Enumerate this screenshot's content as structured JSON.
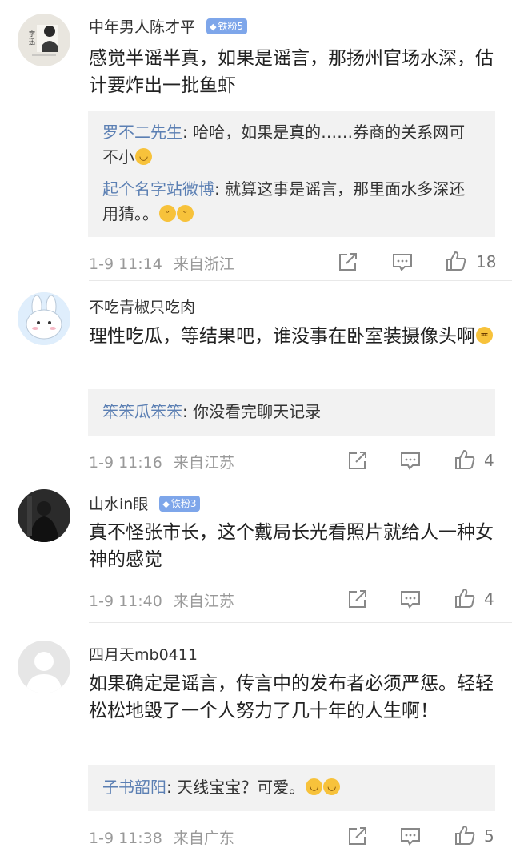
{
  "comments": [
    {
      "user": "中年男人陈才平",
      "badge": "铁粉5",
      "text": "感觉半谣半真，如果是谣言，那扬州官场水深，估计要炸出一批鱼虾",
      "replies": [
        {
          "name": "罗不二先生",
          "text": "哈哈，如果是真的……券商的关系网可不小"
        },
        {
          "name": "起个名字站微博",
          "text": "就算这事是谣言，那里面水多深还用猜。。"
        }
      ],
      "date": "1-9 11:14",
      "location": "来自浙江",
      "likes": "18"
    },
    {
      "user": "不吃青椒只吃肉",
      "badge": "",
      "text": "理性吃瓜，等结果吧，谁没事在卧室装摄像头啊",
      "replies": [
        {
          "name": "笨笨瓜笨笨",
          "text": "你没看完聊天记录"
        }
      ],
      "date": "1-9 11:16",
      "location": "来自江苏",
      "likes": "4"
    },
    {
      "user": "山水in眼",
      "badge": "铁粉3",
      "text": "真不怪张市长，这个戴局长光看照片就给人一种女神的感觉",
      "replies": [],
      "date": "1-9 11:40",
      "location": "来自江苏",
      "likes": "4"
    },
    {
      "user": "四月天mb0411",
      "badge": "",
      "text": "如果确定是谣言，传言中的发布者必须严惩。轻轻松松地毁了一个人努力了几十年的人生啊！",
      "replies": [
        {
          "name": "子书韶阳",
          "text": "天线宝宝？可爱。"
        }
      ],
      "date": "1-9 11:38",
      "location": "来自广东",
      "likes": "5"
    }
  ],
  "icons": {
    "badge": "diamond-icon",
    "share": "share-icon",
    "comment": "comment-icon",
    "like": "thumbs-up-icon"
  },
  "colors": {
    "badge_bg": "#7ea6ea",
    "reply_name": "#5b7fb3",
    "reply_bg": "#f2f2f2",
    "meta": "#999999"
  }
}
